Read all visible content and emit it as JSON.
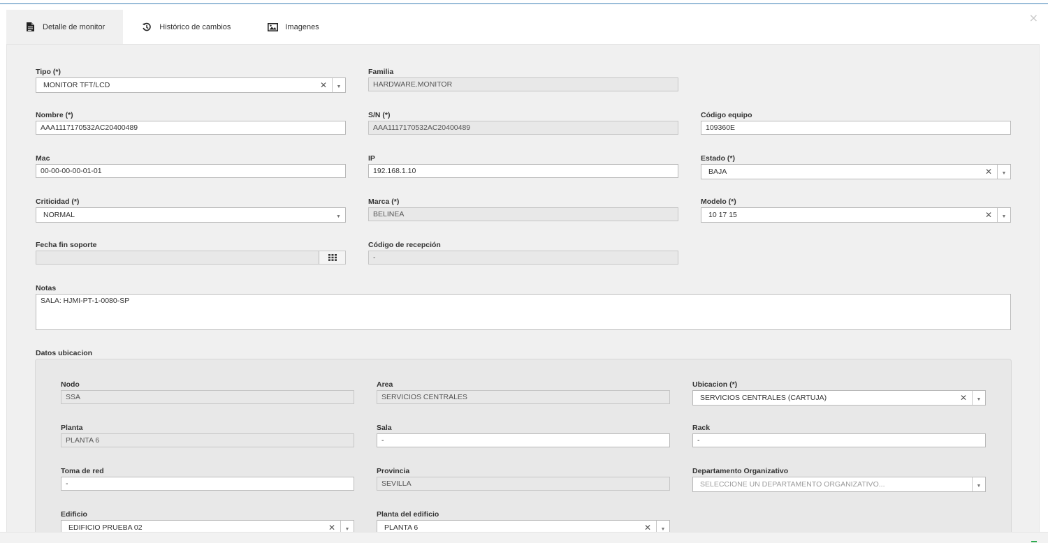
{
  "tabs": [
    {
      "label": "Detalle de monitor",
      "icon": "document-icon"
    },
    {
      "label": "Histórico de cambios",
      "icon": "history-icon"
    },
    {
      "label": "Imagenes",
      "icon": "image-icon"
    }
  ],
  "close_label": "×",
  "fields": {
    "tipo": {
      "label": "Tipo (*)",
      "value": "MONITOR TFT/LCD"
    },
    "familia": {
      "label": "Familia",
      "value": "HARDWARE.MONITOR"
    },
    "nombre": {
      "label": "Nombre (*)",
      "value": "AAA1117170532AC20400489"
    },
    "sn": {
      "label": "S/N (*)",
      "value": "AAA1117170532AC20400489"
    },
    "codigo_equipo": {
      "label": "Código equipo",
      "value": "109360E"
    },
    "mac": {
      "label": "Mac",
      "value": "00-00-00-00-01-01"
    },
    "ip": {
      "label": "IP",
      "value": "192.168.1.10"
    },
    "estado": {
      "label": "Estado (*)",
      "value": "BAJA"
    },
    "criticidad": {
      "label": "Criticidad (*)",
      "value": "NORMAL"
    },
    "marca": {
      "label": "Marca (*)",
      "value": "BELINEA"
    },
    "modelo": {
      "label": "Modelo (*)",
      "value": "10 17 15"
    },
    "fecha_fin_soporte": {
      "label": "Fecha fin soporte",
      "value": ""
    },
    "codigo_recepcion": {
      "label": "Código de recepción",
      "value": "-"
    },
    "notas": {
      "label": "Notas",
      "value": "SALA: HJMI-PT-1-0080-SP"
    }
  },
  "ubicacion": {
    "title": "Datos ubicacion",
    "nodo": {
      "label": "Nodo",
      "value": "SSA"
    },
    "area": {
      "label": "Area",
      "value": "SERVICIOS CENTRALES"
    },
    "ubicacion": {
      "label": "Ubicacion (*)",
      "value": "SERVICIOS CENTRALES (CARTUJA)"
    },
    "planta": {
      "label": "Planta",
      "value": "PLANTA 6"
    },
    "sala": {
      "label": "Sala",
      "value": "-"
    },
    "rack": {
      "label": "Rack",
      "value": "-"
    },
    "toma_red": {
      "label": "Toma de red",
      "value": "-"
    },
    "provincia": {
      "label": "Provincia",
      "value": "SEVILLA"
    },
    "departamento": {
      "label": "Departamento Organizativo",
      "placeholder": "SELECCIONE UN DEPARTAMENTO ORGANIZATIVO..."
    },
    "edificio": {
      "label": "Edificio",
      "value": "EDIFICIO PRUEBA 02"
    },
    "planta_edificio": {
      "label": "Planta del edificio",
      "value": "PLANTA 6"
    }
  },
  "colors": {
    "accent_line": "#3a7fb5",
    "panel_bg": "#f0f0f0",
    "readonly_bg": "#e8e8e8",
    "footer_mark": "#2eaa4f"
  }
}
